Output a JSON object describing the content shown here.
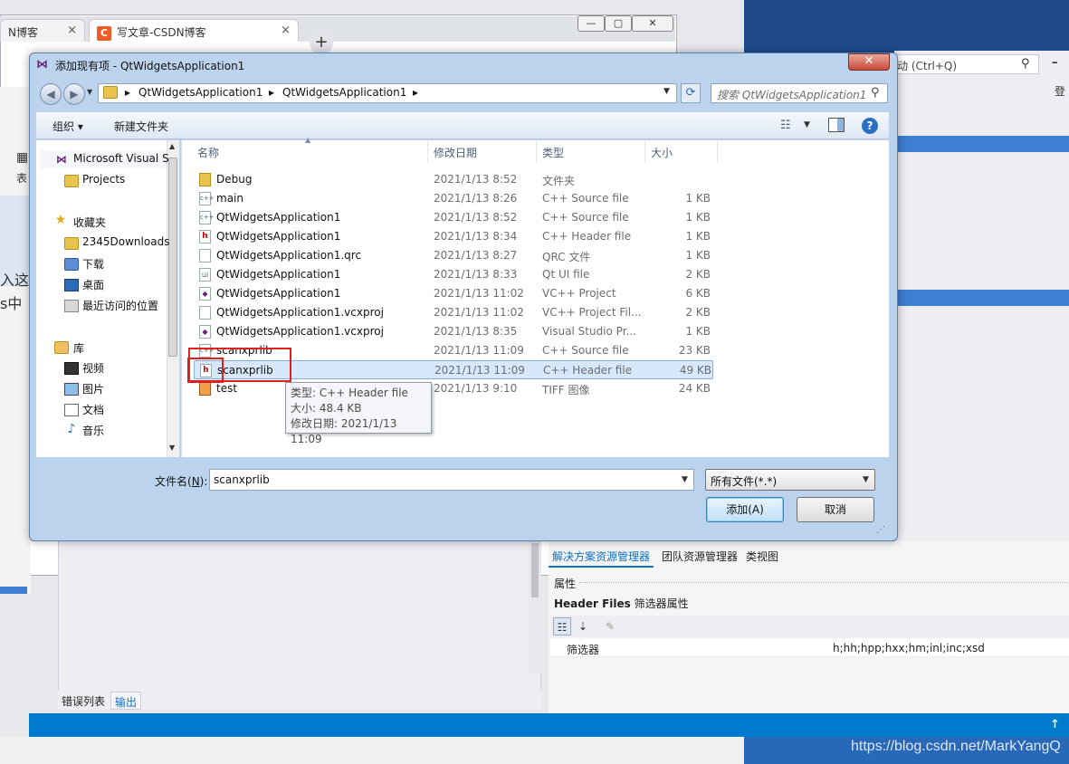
{
  "browser": {
    "tab1_label": "N博客",
    "tab2_label": "写文章-CSDN博客",
    "tab2_favicon": "C",
    "close_glyph": "×",
    "new_tab_glyph": "+",
    "win_min": "—",
    "win_max": "▢",
    "win_close": "✕"
  },
  "vs": {
    "search_text": "动 (Ctrl+Q)",
    "login_text": "登",
    "left_text1": "入这",
    "left_text2": "s中",
    "left_tbl": "表",
    "output_tabs": [
      "错误列表",
      "输出"
    ],
    "right_tabs": [
      "解决方案资源管理器",
      "团队资源管理器",
      "类视图"
    ],
    "props_title": "属性",
    "props_header_bold": "Header Files",
    "props_header_rest": " 筛选器属性",
    "prop_key": "筛选器",
    "prop_value": "h;hh;hpp;hxx;hm;inl;inc;xsd",
    "watermark": "https://blog.csdn.net/MarkYangQ"
  },
  "dialog": {
    "title": "添加现有项 - QtWidgetsApplication1",
    "close_glyph": "✕",
    "breadcrumb": [
      "QtWidgetsApplication1",
      "QtWidgetsApplication1"
    ],
    "search_placeholder": "搜索 QtWidgetsApplication1",
    "toolbar": {
      "organize": "组织 ▾",
      "new_folder": "新建文件夹",
      "help": "?"
    },
    "nav": {
      "vs_item": "Microsoft Visual S",
      "projects": "Projects",
      "favorites": "收藏夹",
      "fav_items": [
        "2345Downloads",
        "下载",
        "桌面",
        "最近访问的位置"
      ],
      "libraries": "库",
      "lib_items": [
        "视频",
        "图片",
        "文档",
        "音乐"
      ]
    },
    "columns": {
      "name": "名称",
      "date": "修改日期",
      "type": "类型",
      "size": "大小"
    },
    "files": [
      {
        "name": "Debug",
        "date": "2021/1/13 8:52",
        "type": "文件夹",
        "size": "",
        "icon": "folder"
      },
      {
        "name": "main",
        "date": "2021/1/13 8:26",
        "type": "C++ Source file",
        "size": "1 KB",
        "icon": "cpp"
      },
      {
        "name": "QtWidgetsApplication1",
        "date": "2021/1/13 8:52",
        "type": "C++ Source file",
        "size": "1 KB",
        "icon": "cpp"
      },
      {
        "name": "QtWidgetsApplication1",
        "date": "2021/1/13 8:34",
        "type": "C++ Header file",
        "size": "1 KB",
        "icon": "h"
      },
      {
        "name": "QtWidgetsApplication1.qrc",
        "date": "2021/1/13 8:27",
        "type": "QRC 文件",
        "size": "1 KB",
        "icon": "file"
      },
      {
        "name": "QtWidgetsApplication1",
        "date": "2021/1/13 8:33",
        "type": "Qt UI file",
        "size": "2 KB",
        "icon": "ui"
      },
      {
        "name": "QtWidgetsApplication1",
        "date": "2021/1/13 11:02",
        "type": "VC++ Project",
        "size": "6 KB",
        "icon": "vc"
      },
      {
        "name": "QtWidgetsApplication1.vcxproj",
        "date": "2021/1/13 11:02",
        "type": "VC++ Project Fil...",
        "size": "2 KB",
        "icon": "file"
      },
      {
        "name": "QtWidgetsApplication1.vcxproj",
        "date": "2021/1/13 8:35",
        "type": "Visual Studio Pr...",
        "size": "1 KB",
        "icon": "vc"
      },
      {
        "name": "scanxprlib",
        "date": "2021/1/13 11:09",
        "type": "C++ Source file",
        "size": "23 KB",
        "icon": "cpp"
      },
      {
        "name": "scanxprlib",
        "date": "2021/1/13 11:09",
        "type": "C++ Header file",
        "size": "49 KB",
        "icon": "h"
      },
      {
        "name": "test",
        "date": "2021/1/13 9:10",
        "type": "TIFF 图像",
        "size": "24 KB",
        "icon": "tiff"
      }
    ],
    "tooltip": {
      "type_line": "类型: C++ Header file",
      "size_line": "大小: 48.4 KB",
      "date_line": "修改日期: 2021/1/13 11:09"
    },
    "filename_label": "文件名(",
    "filename_key": "N",
    "filename_label_end": "):",
    "filename_value": "scanxprlib",
    "filetype_value": "所有文件(*.*)",
    "add_button": "添加(A)",
    "cancel_button": "取消"
  },
  "colors": {
    "accent": "#007acc",
    "highlight_red": "#e0201c",
    "selection": "#d7e8fb"
  }
}
